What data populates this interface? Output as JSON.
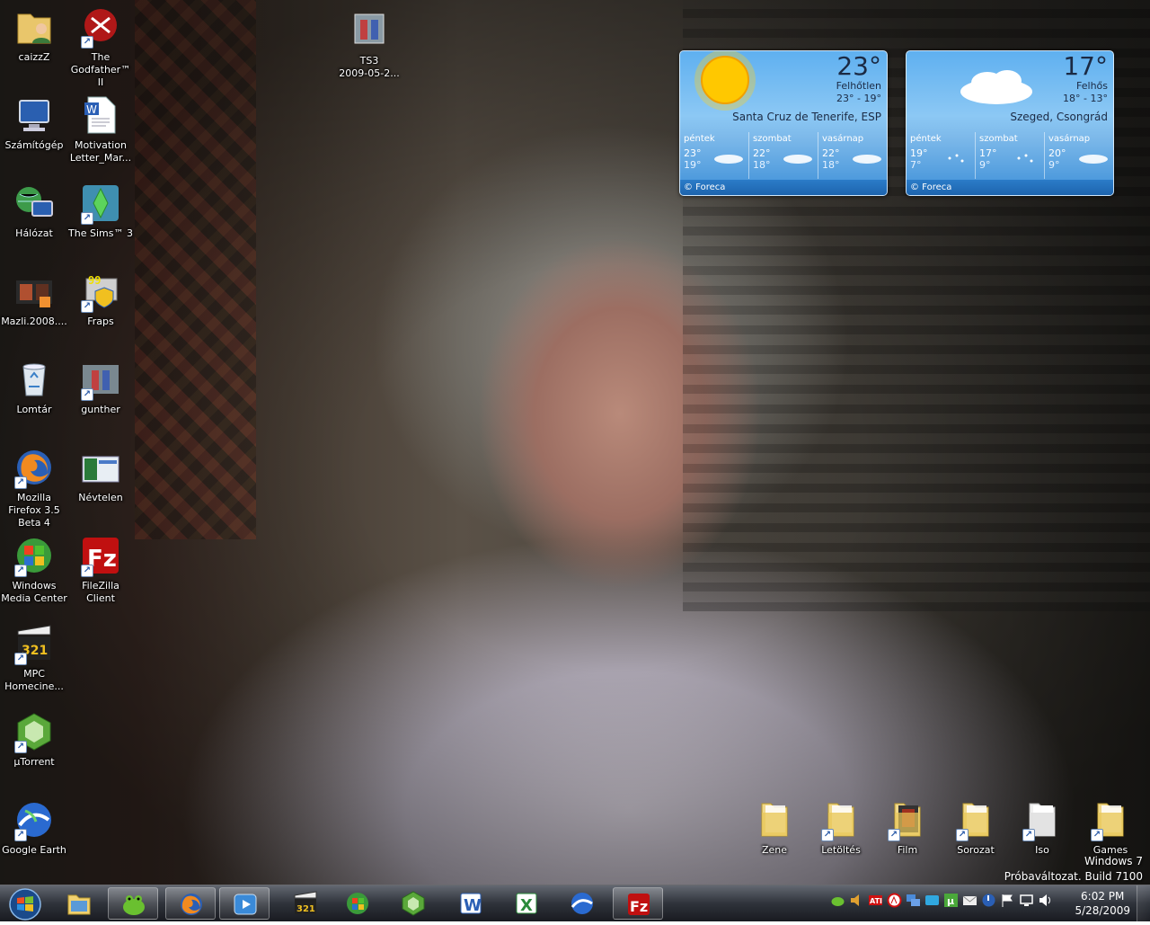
{
  "desktop": {
    "icons_left": [
      {
        "label": "caizzZ",
        "icon": "user-folder-icon"
      },
      {
        "label": "The\nGodfather™ II",
        "icon": "godfather-game-icon"
      },
      {
        "label": "Számítógép",
        "icon": "computer-icon"
      },
      {
        "label": "Motivation\nLetter_Mar...",
        "icon": "word-document-icon"
      },
      {
        "label": "Hálózat",
        "icon": "network-icon"
      },
      {
        "label": "The Sims™ 3",
        "icon": "sims-icon"
      },
      {
        "label": "Mazli.2008....",
        "icon": "video-file-icon"
      },
      {
        "label": "Fraps",
        "icon": "fraps-icon"
      },
      {
        "label": "Lomtár",
        "icon": "recycle-bin-icon"
      },
      {
        "label": "gunther",
        "icon": "image-file-icon"
      },
      {
        "label": "Mozilla\nFirefox 3.5\nBeta 4",
        "icon": "firefox-icon"
      },
      {
        "label": "Névtelen",
        "icon": "screenshot-file-icon"
      },
      {
        "label": "Windows\nMedia Center",
        "icon": "media-center-icon"
      },
      {
        "label": "FileZilla\nClient",
        "icon": "filezilla-icon"
      },
      {
        "label": "MPC\nHomecine...",
        "icon": "mpc-icon"
      },
      {
        "label": "µTorrent",
        "icon": "utorrent-icon"
      },
      {
        "label": "Google Earth",
        "icon": "google-earth-icon"
      }
    ],
    "top_icon": {
      "label": "TS3\n2009-05-2...",
      "icon": "image-file-icon"
    },
    "folders_bottom": [
      {
        "label": "Zene"
      },
      {
        "label": "Letöltés"
      },
      {
        "label": "Film"
      },
      {
        "label": "Sorozat"
      },
      {
        "label": "Iso"
      },
      {
        "label": "Games"
      }
    ]
  },
  "weather": [
    {
      "temp": "23°",
      "condition": "Felhőtlen",
      "range": "23° - 19°",
      "location": "Santa Cruz de Tenerife, ESP",
      "days": [
        {
          "name": "péntek",
          "hi": "23°",
          "lo": "19°"
        },
        {
          "name": "szombat",
          "hi": "22°",
          "lo": "18°"
        },
        {
          "name": "vasárnap",
          "hi": "22°",
          "lo": "18°"
        }
      ],
      "footer": "© Foreca"
    },
    {
      "temp": "17°",
      "condition": "Felhős",
      "range": "18° - 13°",
      "location": "Szeged, Csongrád",
      "days": [
        {
          "name": "péntek",
          "hi": "19°",
          "lo": "7°"
        },
        {
          "name": "szombat",
          "hi": "17°",
          "lo": "9°"
        },
        {
          "name": "vasárnap",
          "hi": "20°",
          "lo": "9°"
        }
      ],
      "footer": "© Foreca"
    }
  ],
  "watermark": {
    "line1": "Windows 7",
    "line2": "Próbaváltozat. Build 7100"
  },
  "taskbar": {
    "pinned": [
      "explorer-icon",
      "frog-app-icon",
      "firefox-icon",
      "media-player-icon",
      "mpc-icon",
      "media-center-icon",
      "utorrent-icon",
      "word-icon",
      "excel-icon",
      "google-earth-icon",
      "filezilla-icon"
    ],
    "clock_time": "6:02 PM",
    "clock_date": "5/28/2009"
  }
}
